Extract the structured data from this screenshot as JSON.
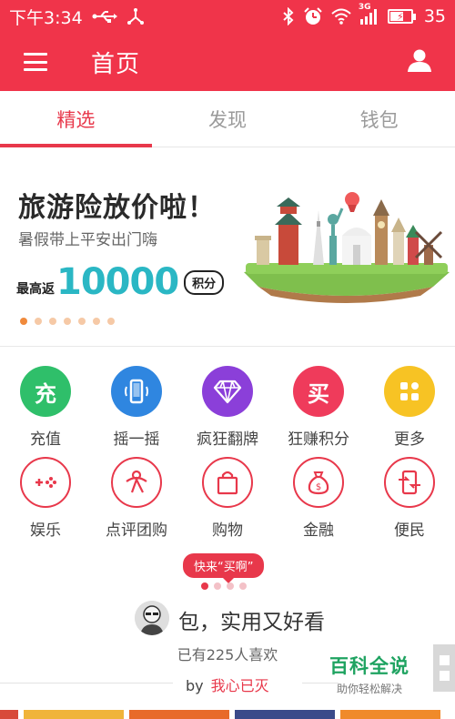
{
  "status_bar": {
    "time": "下午3:34",
    "battery": "35",
    "network": "3G",
    "icons": [
      "usb-icon",
      "debug-icon",
      "bluetooth-icon",
      "alarm-icon",
      "wifi-icon",
      "signal-icon",
      "battery-icon"
    ]
  },
  "app_bar": {
    "title": "首页",
    "icons": [
      "menu-icon",
      "user-icon"
    ]
  },
  "tabs": [
    {
      "label": "精选",
      "active": true
    },
    {
      "label": "发现",
      "active": false
    },
    {
      "label": "钱包",
      "active": false
    }
  ],
  "banner": {
    "headline": "旅游险放价啦！",
    "subtitle": "暑假带上平安出门嗨",
    "cashback_label": "最高返",
    "cashback_amount": "10000",
    "cashback_unit": "积分",
    "slide_count": 7,
    "active_slide": 1
  },
  "grid": [
    {
      "label": "充值",
      "icon": "recharge-icon",
      "glyph": "充",
      "color": "#2fbf6a"
    },
    {
      "label": "摇一摇",
      "icon": "phone-shake-icon",
      "color": "#2f86e0"
    },
    {
      "label": "疯狂翻牌",
      "icon": "diamond-icon",
      "color": "#8b3fd9"
    },
    {
      "label": "狂赚积分",
      "icon": "buy-icon",
      "glyph": "买",
      "color": "#ef3b5b"
    },
    {
      "label": "更多",
      "icon": "more-grid-icon",
      "color": "#f7c324"
    },
    {
      "label": "娱乐",
      "icon": "gamepad-icon",
      "color": "#e8384b"
    },
    {
      "label": "点评团购",
      "icon": "review-group-icon",
      "color": "#e8384b"
    },
    {
      "label": "购物",
      "icon": "shopping-bag-icon",
      "color": "#e8384b"
    },
    {
      "label": "金融",
      "icon": "money-bag-icon",
      "color": "#e8384b"
    },
    {
      "label": "便民",
      "icon": "convenience-icon",
      "color": "#e8384b"
    }
  ],
  "feed": {
    "badge": "快来“买啊”",
    "title": "包，实用又好看",
    "likes": "已有225人喜欢",
    "by": "by",
    "author": "我心已灭",
    "page_count": 4,
    "active_page": 1
  },
  "watermark": {
    "name": "百科全说",
    "slogan": "助你轻松解决"
  },
  "colors": {
    "brand": "#f0344a",
    "accent": "#e8384b",
    "cashback": "#2ab7c4",
    "watermark": "#1fa361"
  }
}
